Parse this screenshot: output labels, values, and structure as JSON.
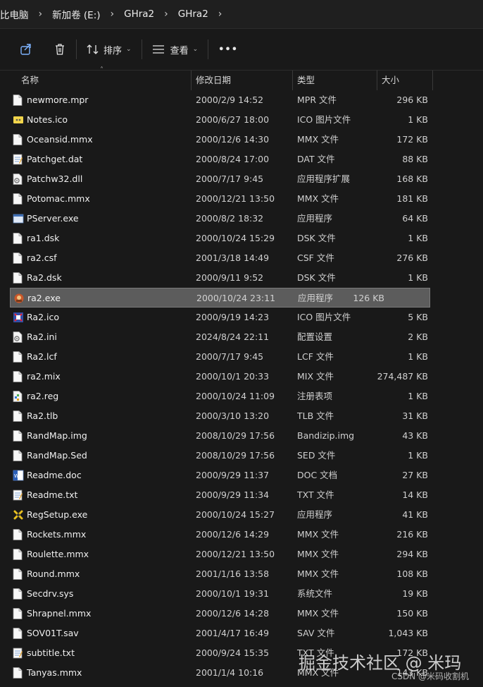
{
  "breadcrumbs": [
    "比电脑",
    "新加卷 (E:)",
    "GHra2",
    "GHra2"
  ],
  "toolbar": {
    "sort_label": "排序",
    "view_label": "查看",
    "more_label": "•••"
  },
  "columns": {
    "name": "名称",
    "date": "修改日期",
    "type": "类型",
    "size": "大小"
  },
  "files": [
    {
      "name": "newmore.mpr",
      "date": "2000/2/9 14:52",
      "type": "MPR 文件",
      "size": "296 KB",
      "icon": "file-icon"
    },
    {
      "name": "Notes.ico",
      "date": "2000/6/27 18:00",
      "type": "ICO 图片文件",
      "size": "1 KB",
      "icon": "note-icon"
    },
    {
      "name": "Oceansid.mmx",
      "date": "2000/12/6 14:30",
      "type": "MMX 文件",
      "size": "172 KB",
      "icon": "file-icon"
    },
    {
      "name": "Patchget.dat",
      "date": "2000/8/24 17:00",
      "type": "DAT 文件",
      "size": "88 KB",
      "icon": "notepad-icon"
    },
    {
      "name": "Patchw32.dll",
      "date": "2000/7/17 9:45",
      "type": "应用程序扩展",
      "size": "168 KB",
      "icon": "gear-file-icon"
    },
    {
      "name": "Potomac.mmx",
      "date": "2000/12/21 13:50",
      "type": "MMX 文件",
      "size": "181 KB",
      "icon": "file-icon"
    },
    {
      "name": "PServer.exe",
      "date": "2000/8/2 18:32",
      "type": "应用程序",
      "size": "64 KB",
      "icon": "app-window-icon"
    },
    {
      "name": "ra1.dsk",
      "date": "2000/10/24 15:29",
      "type": "DSK 文件",
      "size": "1 KB",
      "icon": "file-icon"
    },
    {
      "name": "ra2.csf",
      "date": "2001/3/18 14:49",
      "type": "CSF 文件",
      "size": "276 KB",
      "icon": "file-icon"
    },
    {
      "name": "Ra2.dsk",
      "date": "2000/9/11 9:52",
      "type": "DSK 文件",
      "size": "1 KB",
      "icon": "file-icon"
    },
    {
      "name": "ra2.exe",
      "date": "2000/10/24 23:11",
      "type": "应用程序",
      "size": "126 KB",
      "icon": "ra2-exe-icon",
      "selected": true
    },
    {
      "name": "Ra2.ico",
      "date": "2000/9/19 14:23",
      "type": "ICO 图片文件",
      "size": "5 KB",
      "icon": "ra2-ico-icon"
    },
    {
      "name": "Ra2.ini",
      "date": "2024/8/24 22:11",
      "type": "配置设置",
      "size": "2 KB",
      "icon": "gear-file-icon"
    },
    {
      "name": "Ra2.lcf",
      "date": "2000/7/17 9:45",
      "type": "LCF 文件",
      "size": "1 KB",
      "icon": "file-icon"
    },
    {
      "name": "ra2.mix",
      "date": "2000/10/1 20:33",
      "type": "MIX 文件",
      "size": "274,487 KB",
      "icon": "file-icon"
    },
    {
      "name": "ra2.reg",
      "date": "2000/10/24 11:09",
      "type": "注册表项",
      "size": "1 KB",
      "icon": "registry-icon"
    },
    {
      "name": "Ra2.tlb",
      "date": "2000/3/10 13:20",
      "type": "TLB 文件",
      "size": "31 KB",
      "icon": "file-icon"
    },
    {
      "name": "RandMap.img",
      "date": "2008/10/29 17:56",
      "type": "Bandizip.img",
      "size": "43 KB",
      "icon": "file-icon"
    },
    {
      "name": "RandMap.Sed",
      "date": "2008/10/29 17:56",
      "type": "SED 文件",
      "size": "1 KB",
      "icon": "file-icon"
    },
    {
      "name": "Readme.doc",
      "date": "2000/9/29 11:37",
      "type": "DOC 文档",
      "size": "27 KB",
      "icon": "doc-icon"
    },
    {
      "name": "Readme.txt",
      "date": "2000/9/29 11:34",
      "type": "TXT 文件",
      "size": "14 KB",
      "icon": "notepad-icon"
    },
    {
      "name": "RegSetup.exe",
      "date": "2000/10/24 15:27",
      "type": "应用程序",
      "size": "41 KB",
      "icon": "regsetup-icon"
    },
    {
      "name": "Rockets.mmx",
      "date": "2000/12/6 14:29",
      "type": "MMX 文件",
      "size": "216 KB",
      "icon": "file-icon"
    },
    {
      "name": "Roulette.mmx",
      "date": "2000/12/21 13:50",
      "type": "MMX 文件",
      "size": "294 KB",
      "icon": "file-icon"
    },
    {
      "name": "Round.mmx",
      "date": "2001/1/16 13:58",
      "type": "MMX 文件",
      "size": "108 KB",
      "icon": "file-icon"
    },
    {
      "name": "Secdrv.sys",
      "date": "2000/10/1 19:31",
      "type": "系统文件",
      "size": "19 KB",
      "icon": "file-icon"
    },
    {
      "name": "Shrapnel.mmx",
      "date": "2000/12/6 14:28",
      "type": "MMX 文件",
      "size": "150 KB",
      "icon": "file-icon"
    },
    {
      "name": "SOV01T.sav",
      "date": "2001/4/17 16:49",
      "type": "SAV 文件",
      "size": "1,043 KB",
      "icon": "file-icon"
    },
    {
      "name": "subtitle.txt",
      "date": "2000/9/24 15:35",
      "type": "TXT 文件",
      "size": "172 KB",
      "icon": "notepad-icon"
    },
    {
      "name": "Tanyas.mmx",
      "date": "2001/1/4 10:16",
      "type": "MMX 文件",
      "size": "143 KB",
      "icon": "file-icon"
    }
  ],
  "watermark": {
    "main": "掘金技术社区 @ 米玛",
    "sub": "CSDN @米码收割机"
  }
}
